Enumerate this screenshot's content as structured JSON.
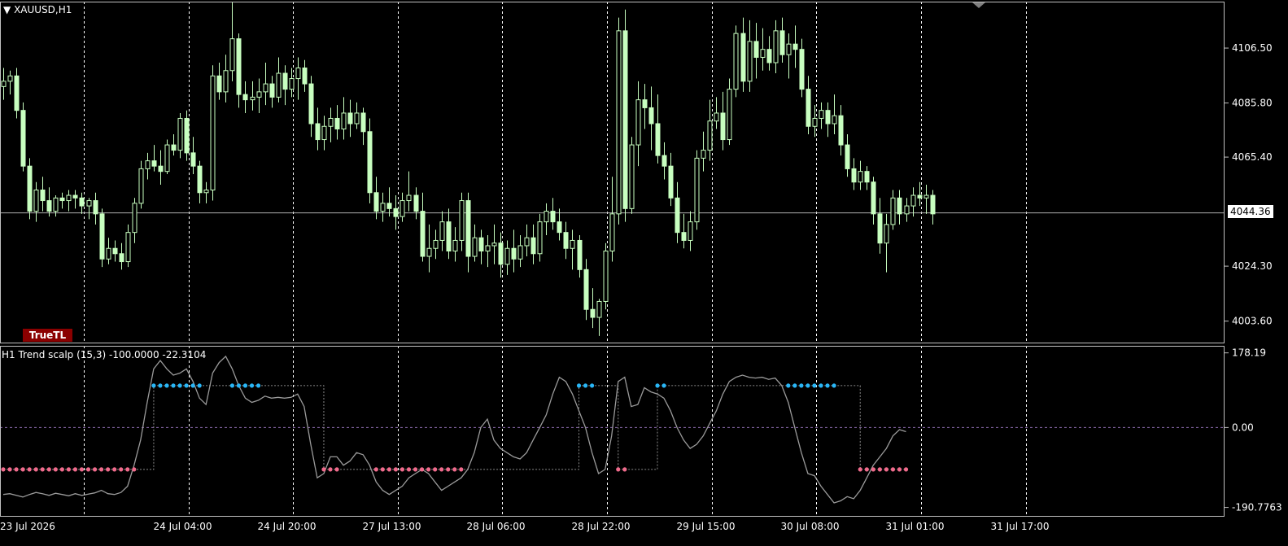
{
  "window": {
    "symbol_title": "XAUUSD,H1",
    "badge": "TrueTL"
  },
  "current_price": {
    "label": "4044.36",
    "value": 4044.36
  },
  "colors": {
    "background": "#000000",
    "candle_bull": "#c8ffc0",
    "candle_bear": "#c8ffc0",
    "grid": "#ffffff",
    "osc_line": "#9a9a9a",
    "dot_up": "#29b6f6",
    "dot_down": "#f06b8c",
    "badge": "#8b0000",
    "level_line": "#8e6bb0"
  },
  "chart_data": [
    {
      "type": "candlestick",
      "title": "XAUUSD,H1",
      "y_ticks": [
        "4106.50",
        "4085.80",
        "4065.40",
        "4024.30",
        "4003.60"
      ],
      "y_tick_values": [
        4106.5,
        4085.8,
        4065.4,
        4024.3,
        4003.6
      ],
      "ylim": [
        3995.5,
        4124.0
      ],
      "x_ticks": [
        "23 Jul 2026",
        "24 Jul 04:00",
        "24 Jul 20:00",
        "27 Jul 13:00",
        "28 Jul 06:00",
        "28 Jul 22:00",
        "29 Jul 15:00",
        "30 Jul 08:00",
        "31 Jul 01:00",
        "31 Jul 17:00"
      ],
      "x_tick_index": [
        0,
        16,
        32,
        48,
        64,
        80,
        96,
        112,
        128,
        144
      ],
      "grid": "dashed-vertical",
      "ohlc": [
        [
          4092,
          4099,
          4087,
          4094
        ],
        [
          4094,
          4098,
          4089,
          4096
        ],
        [
          4096,
          4099,
          4080,
          4083
        ],
        [
          4083,
          4086,
          4060,
          4062
        ],
        [
          4062,
          4065,
          4042,
          4045
        ],
        [
          4045,
          4056,
          4041,
          4053
        ],
        [
          4053,
          4058,
          4045,
          4049
        ],
        [
          4049,
          4054,
          4043,
          4045
        ],
        [
          4045,
          4051,
          4043,
          4050
        ],
        [
          4050,
          4052,
          4046,
          4049
        ],
        [
          4049,
          4053,
          4045,
          4051
        ],
        [
          4051,
          4053,
          4046,
          4050
        ],
        [
          4050,
          4052,
          4044,
          4047
        ],
        [
          4047,
          4050,
          4042,
          4049
        ],
        [
          4049,
          4052,
          4040,
          4044
        ],
        [
          4044,
          4046,
          4024,
          4027
        ],
        [
          4027,
          4035,
          4025,
          4031
        ],
        [
          4031,
          4034,
          4026,
          4029
        ],
        [
          4029,
          4033,
          4023,
          4026
        ],
        [
          4026,
          4040,
          4024,
          4037
        ],
        [
          4037,
          4050,
          4033,
          4048
        ],
        [
          4048,
          4064,
          4046,
          4061
        ],
        [
          4061,
          4067,
          4057,
          4064
        ],
        [
          4064,
          4070,
          4060,
          4062
        ],
        [
          4062,
          4068,
          4055,
          4060
        ],
        [
          4060,
          4072,
          4059,
          4070
        ],
        [
          4070,
          4074,
          4066,
          4068
        ],
        [
          4068,
          4082,
          4065,
          4080
        ],
        [
          4080,
          4083,
          4064,
          4067
        ],
        [
          4067,
          4073,
          4059,
          4062
        ],
        [
          4062,
          4064,
          4048,
          4052
        ],
        [
          4052,
          4056,
          4048,
          4053
        ],
        [
          4053,
          4100,
          4049,
          4096
        ],
        [
          4096,
          4101,
          4087,
          4090
        ],
        [
          4090,
          4104,
          4086,
          4098
        ],
        [
          4098,
          4124,
          4094,
          4110
        ],
        [
          4110,
          4112,
          4084,
          4089
        ],
        [
          4089,
          4094,
          4082,
          4087
        ],
        [
          4087,
          4094,
          4083,
          4088
        ],
        [
          4088,
          4095,
          4082,
          4090
        ],
        [
          4090,
          4101,
          4085,
          4093
        ],
        [
          4093,
          4096,
          4084,
          4088
        ],
        [
          4088,
          4103,
          4086,
          4097
        ],
        [
          4097,
          4100,
          4085,
          4091
        ],
        [
          4091,
          4099,
          4088,
          4095
        ],
        [
          4095,
          4103,
          4087,
          4099
        ],
        [
          4099,
          4102,
          4090,
          4093
        ],
        [
          4093,
          4096,
          4073,
          4078
        ],
        [
          4078,
          4084,
          4068,
          4072
        ],
        [
          4072,
          4081,
          4068,
          4077
        ],
        [
          4077,
          4084,
          4071,
          4080
        ],
        [
          4080,
          4085,
          4072,
          4076
        ],
        [
          4076,
          4088,
          4072,
          4082
        ],
        [
          4082,
          4087,
          4073,
          4078
        ],
        [
          4078,
          4086,
          4076,
          4082
        ],
        [
          4082,
          4084,
          4070,
          4075
        ],
        [
          4075,
          4080,
          4048,
          4052
        ],
        [
          4052,
          4058,
          4042,
          4045
        ],
        [
          4045,
          4052,
          4041,
          4048
        ],
        [
          4048,
          4054,
          4043,
          4046
        ],
        [
          4046,
          4051,
          4038,
          4043
        ],
        [
          4043,
          4052,
          4041,
          4049
        ],
        [
          4049,
          4060,
          4045,
          4051
        ],
        [
          4051,
          4054,
          4042,
          4045
        ],
        [
          4045,
          4052,
          4026,
          4028
        ],
        [
          4028,
          4040,
          4022,
          4031
        ],
        [
          4031,
          4038,
          4027,
          4034
        ],
        [
          4034,
          4045,
          4030,
          4041
        ],
        [
          4041,
          4046,
          4027,
          4030
        ],
        [
          4030,
          4039,
          4026,
          4034
        ],
        [
          4034,
          4052,
          4030,
          4049
        ],
        [
          4049,
          4052,
          4022,
          4028
        ],
        [
          4028,
          4040,
          4026,
          4035
        ],
        [
          4035,
          4038,
          4025,
          4030
        ],
        [
          4030,
          4036,
          4024,
          4032
        ],
        [
          4032,
          4040,
          4025,
          4033
        ],
        [
          4033,
          4037,
          4020,
          4025
        ],
        [
          4025,
          4034,
          4021,
          4031
        ],
        [
          4031,
          4038,
          4022,
          4027
        ],
        [
          4027,
          4036,
          4024,
          4032
        ],
        [
          4032,
          4040,
          4028,
          4035
        ],
        [
          4035,
          4040,
          4025,
          4029
        ],
        [
          4029,
          4044,
          4026,
          4041
        ],
        [
          4041,
          4048,
          4036,
          4045
        ],
        [
          4045,
          4050,
          4038,
          4041
        ],
        [
          4041,
          4046,
          4034,
          4037
        ],
        [
          4037,
          4041,
          4027,
          4031
        ],
        [
          4031,
          4038,
          4023,
          4034
        ],
        [
          4034,
          4036,
          4020,
          4023
        ],
        [
          4023,
          4027,
          4004,
          4008
        ],
        [
          4008,
          4016,
          4001,
          4005
        ],
        [
          4005,
          4012,
          3998,
          4011
        ],
        [
          4011,
          4033,
          4008,
          4030
        ],
        [
          4030,
          4058,
          4026,
          4044
        ],
        [
          4044,
          4118,
          4040,
          4113
        ],
        [
          4113,
          4121,
          4041,
          4046
        ],
        [
          4046,
          4073,
          4044,
          4070
        ],
        [
          4070,
          4094,
          4062,
          4087
        ],
        [
          4087,
          4093,
          4076,
          4084
        ],
        [
          4084,
          4092,
          4068,
          4078
        ],
        [
          4078,
          4089,
          4063,
          4066
        ],
        [
          4066,
          4071,
          4057,
          4062
        ],
        [
          4062,
          4067,
          4047,
          4050
        ],
        [
          4050,
          4056,
          4033,
          4037
        ],
        [
          4037,
          4044,
          4031,
          4034
        ],
        [
          4034,
          4045,
          4030,
          4041
        ],
        [
          4041,
          4068,
          4038,
          4065
        ],
        [
          4065,
          4075,
          4060,
          4068
        ],
        [
          4068,
          4087,
          4064,
          4079
        ],
        [
          4079,
          4088,
          4076,
          4082
        ],
        [
          4082,
          4090,
          4068,
          4072
        ],
        [
          4072,
          4095,
          4070,
          4091
        ],
        [
          4091,
          4115,
          4088,
          4112
        ],
        [
          4112,
          4118,
          4090,
          4094
        ],
        [
          4094,
          4117,
          4090,
          4109
        ],
        [
          4109,
          4116,
          4095,
          4103
        ],
        [
          4103,
          4114,
          4098,
          4106
        ],
        [
          4106,
          4111,
          4098,
          4101
        ],
        [
          4101,
          4117,
          4097,
          4113
        ],
        [
          4113,
          4118,
          4101,
          4104
        ],
        [
          4104,
          4112,
          4095,
          4108
        ],
        [
          4108,
          4115,
          4099,
          4106
        ],
        [
          4106,
          4110,
          4088,
          4091
        ],
        [
          4091,
          4096,
          4074,
          4077
        ],
        [
          4077,
          4085,
          4073,
          4080
        ],
        [
          4080,
          4086,
          4076,
          4083
        ],
        [
          4083,
          4086,
          4073,
          4078
        ],
        [
          4078,
          4089,
          4074,
          4081
        ],
        [
          4081,
          4085,
          4066,
          4070
        ],
        [
          4070,
          4074,
          4058,
          4061
        ],
        [
          4061,
          4065,
          4053,
          4056
        ],
        [
          4056,
          4064,
          4053,
          4060
        ],
        [
          4060,
          4062,
          4053,
          4056
        ],
        [
          4056,
          4058,
          4040,
          4044
        ],
        [
          4044,
          4050,
          4029,
          4033
        ],
        [
          4033,
          4044,
          4022,
          4040
        ],
        [
          4040,
          4053,
          4038,
          4050
        ],
        [
          4050,
          4053,
          4040,
          4044
        ],
        [
          4044,
          4050,
          4041,
          4047
        ],
        [
          4047,
          4054,
          4043,
          4051
        ],
        [
          4051,
          4056,
          4047,
          4050
        ],
        [
          4050,
          4055,
          4044,
          4051
        ],
        [
          4051,
          4053,
          4040,
          4044
        ]
      ]
    },
    {
      "type": "line",
      "title": "H1 Trend scalp (15,3) -100.0000 -22.3104",
      "series_name": "Trend scalp (15,3)",
      "y_ticks": [
        "178.19",
        "0.00",
        "-190.7763"
      ],
      "y_tick_values": [
        178.19,
        0,
        -190.7763
      ],
      "ylim": [
        -211,
        195
      ],
      "levels": [
        0
      ],
      "upper_band": 100,
      "lower_band": -100,
      "oscillator": [
        -160,
        -158,
        -162,
        -166,
        -160,
        -155,
        -158,
        -162,
        -157,
        -160,
        -163,
        -158,
        -162,
        -159,
        -156,
        -150,
        -158,
        -160,
        -155,
        -140,
        -90,
        -30,
        60,
        140,
        160,
        140,
        125,
        130,
        140,
        110,
        70,
        55,
        130,
        155,
        170,
        140,
        100,
        70,
        60,
        65,
        75,
        70,
        72,
        70,
        72,
        80,
        50,
        -40,
        -120,
        -110,
        -70,
        -70,
        -90,
        -80,
        -60,
        -65,
        -90,
        -130,
        -150,
        -160,
        -150,
        -140,
        -120,
        -110,
        -100,
        -110,
        -130,
        -150,
        -140,
        -130,
        -120,
        -100,
        -60,
        0,
        20,
        -30,
        -50,
        -60,
        -70,
        -75,
        -60,
        -30,
        0,
        30,
        80,
        120,
        110,
        80,
        40,
        0,
        -60,
        -110,
        -100,
        -20,
        110,
        120,
        50,
        55,
        95,
        85,
        80,
        70,
        40,
        0,
        -30,
        -50,
        -40,
        -20,
        10,
        40,
        80,
        110,
        120,
        125,
        120,
        118,
        120,
        115,
        118,
        100,
        60,
        0,
        -60,
        -110,
        -115,
        -140,
        -160,
        -180,
        -175,
        -165,
        -170,
        -150,
        -120,
        -90,
        -70,
        -50,
        -20,
        -5,
        -10
      ],
      "signal_up_ranges": [
        [
          23,
          30
        ],
        [
          35,
          39
        ],
        [
          88,
          90
        ],
        [
          100,
          101
        ],
        [
          120,
          127
        ]
      ],
      "signal_down_ranges": [
        [
          0,
          20
        ],
        [
          49,
          51
        ],
        [
          57,
          70
        ],
        [
          94,
          95
        ],
        [
          131,
          138
        ]
      ]
    }
  ]
}
